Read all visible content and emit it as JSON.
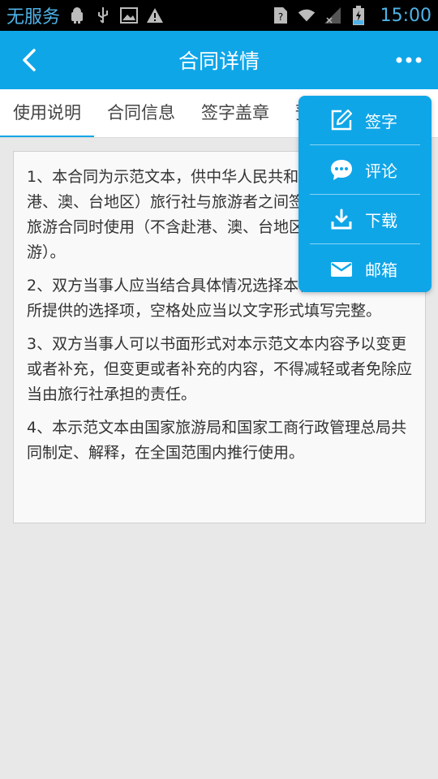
{
  "status_bar": {
    "carrier": "无服务",
    "time": "15:00"
  },
  "header": {
    "title": "合同详情",
    "back_icon": "back-arrow-icon",
    "more_icon": "more-dots-icon"
  },
  "tabs": [
    {
      "label": "使用说明",
      "active": true
    },
    {
      "label": "合同信息",
      "active": false
    },
    {
      "label": "签字盖章",
      "active": false
    },
    {
      "label": "预",
      "active": false
    }
  ],
  "content": {
    "paragraphs": [
      "1、本合同为示范文本，供中华人民共和国境内（不含港、澳、台地区）旅行社与旅游者之间签订团队境内包价旅游合同时使用（不含赴港、澳、台地区旅游及边境游）。",
      "2、双方当事人应当结合具体情况选择本合同协议条款中所提供的选择项，空格处应当以文字形式填写完整。",
      "3、双方当事人可以书面形式对本示范文本内容予以变更或者补充，但变更或者补充的内容，不得减轻或者免除应当由旅行社承担的责任。",
      "4、本示范文本由国家旅游局和国家工商行政管理总局共同制定、解释，在全国范围内推行使用。"
    ]
  },
  "menu": {
    "items": [
      {
        "label": "签字",
        "icon": "sign-edit-icon"
      },
      {
        "label": "评论",
        "icon": "comment-icon"
      },
      {
        "label": "下载",
        "icon": "download-icon"
      },
      {
        "label": "邮箱",
        "icon": "mail-icon"
      }
    ]
  },
  "colors": {
    "primary": "#0fa6e8",
    "status_accent": "#4fb3e8"
  }
}
